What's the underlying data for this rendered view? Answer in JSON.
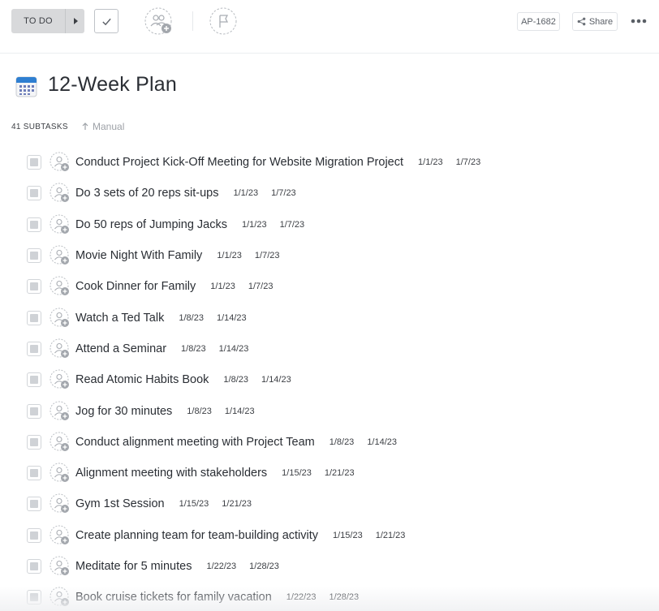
{
  "toolbar": {
    "status_label": "TO DO",
    "task_id": "AP-1682",
    "share_label": "Share"
  },
  "page": {
    "title": "12-Week Plan"
  },
  "subtasks": {
    "count_label": "41 SUBTASKS",
    "sort_label": "Manual",
    "items": [
      {
        "name": "Conduct Project Kick-Off Meeting for Website Migration Project",
        "start": "1/1/23",
        "due": "1/7/23"
      },
      {
        "name": "Do 3 sets of 20 reps sit-ups",
        "start": "1/1/23",
        "due": "1/7/23"
      },
      {
        "name": "Do 50 reps of Jumping Jacks",
        "start": "1/1/23",
        "due": "1/7/23"
      },
      {
        "name": "Movie Night With Family",
        "start": "1/1/23",
        "due": "1/7/23"
      },
      {
        "name": "Cook Dinner for Family",
        "start": "1/1/23",
        "due": "1/7/23"
      },
      {
        "name": "Watch a Ted Talk",
        "start": "1/8/23",
        "due": "1/14/23"
      },
      {
        "name": "Attend a Seminar",
        "start": "1/8/23",
        "due": "1/14/23"
      },
      {
        "name": "Read Atomic Habits Book",
        "start": "1/8/23",
        "due": "1/14/23"
      },
      {
        "name": "Jog for 30 minutes",
        "start": "1/8/23",
        "due": "1/14/23"
      },
      {
        "name": "Conduct alignment meeting with Project Team",
        "start": "1/8/23",
        "due": "1/14/23"
      },
      {
        "name": "Alignment meeting with stakeholders",
        "start": "1/15/23",
        "due": "1/21/23"
      },
      {
        "name": "Gym 1st Session",
        "start": "1/15/23",
        "due": "1/21/23"
      },
      {
        "name": "Create planning team for team-building activity",
        "start": "1/15/23",
        "due": "1/21/23"
      },
      {
        "name": "Meditate for 5 minutes",
        "start": "1/22/23",
        "due": "1/28/23"
      },
      {
        "name": "Book cruise tickets for family vacation",
        "start": "1/22/23",
        "due": "1/28/23"
      }
    ]
  },
  "icons": {
    "status_arrow": "caret-right-icon",
    "complete": "check-icon",
    "assign": "add-assignee-icon",
    "priority": "flag-icon",
    "share": "share-icon",
    "more": "ellipsis-icon",
    "title": "calendar-icon",
    "sort": "arrow-up-icon"
  },
  "colors": {
    "status_bg": "#d8d9db",
    "text": "#2a2e34",
    "muted": "#9da1a7",
    "calendar_blue": "#2f7fd1"
  }
}
